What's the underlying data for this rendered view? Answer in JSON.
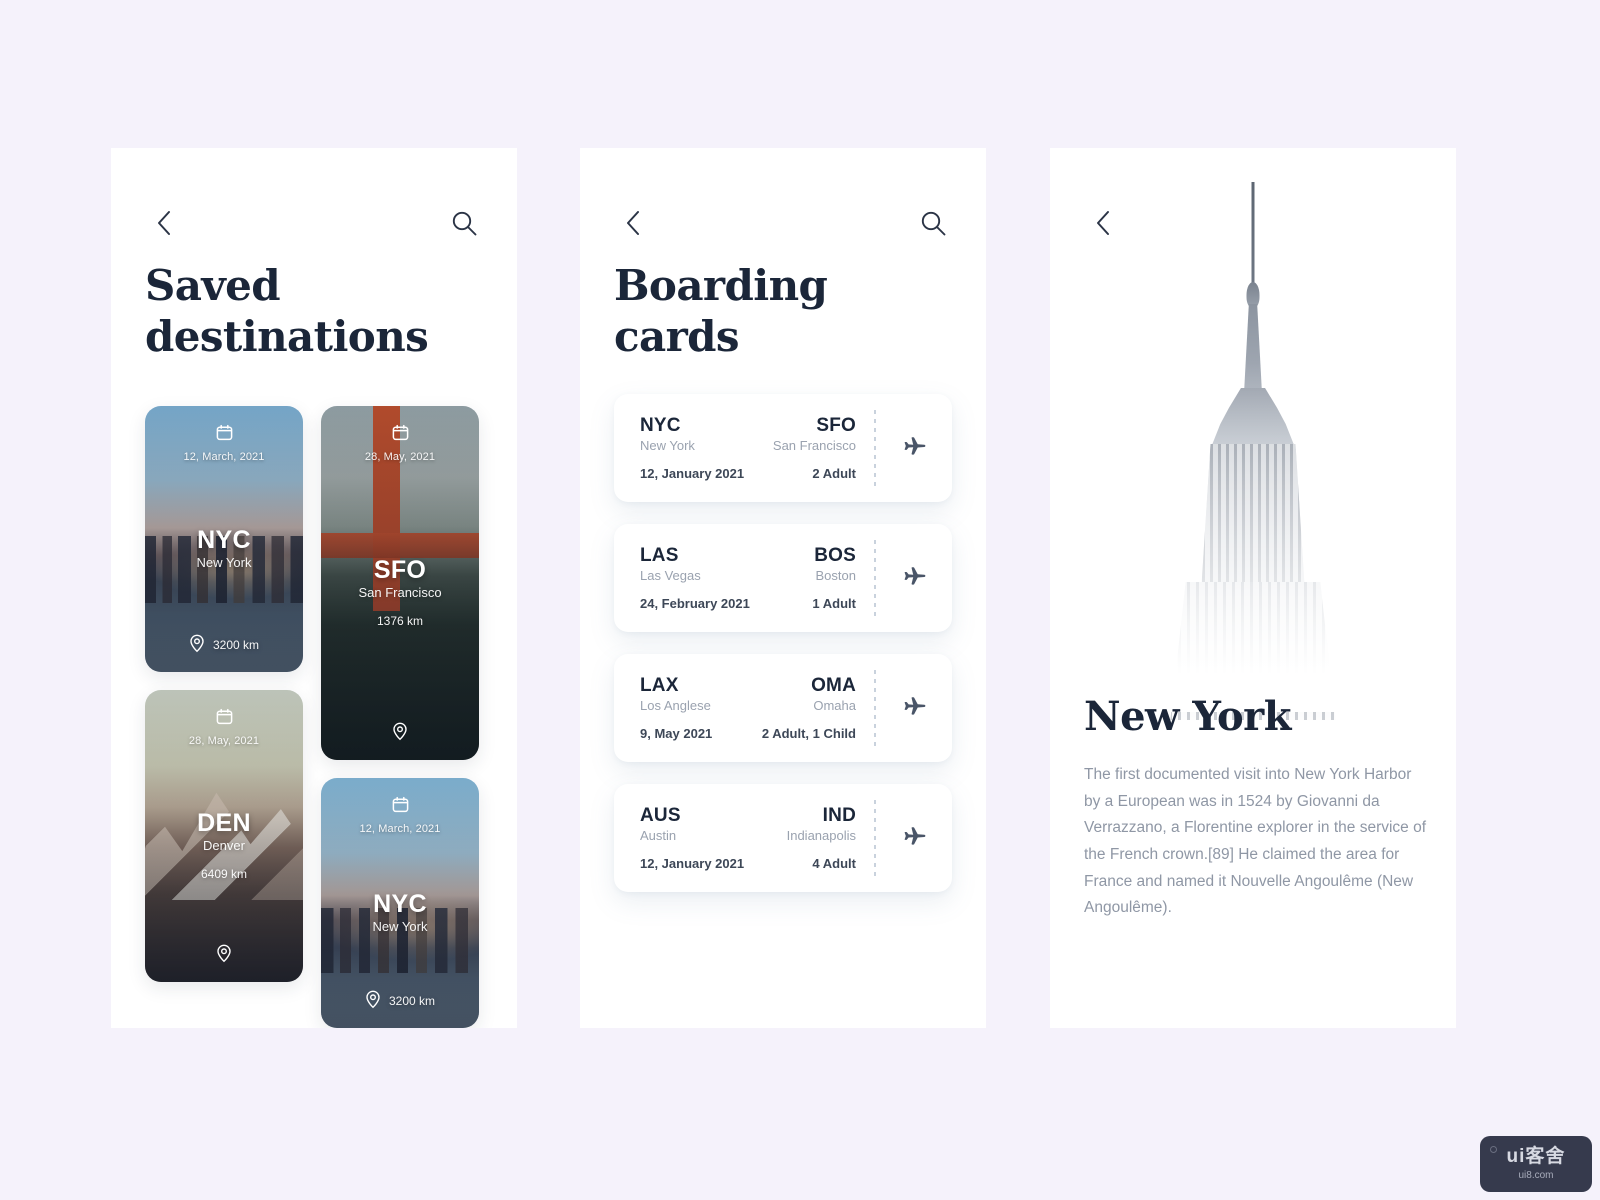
{
  "background_color": "#f5f2fb",
  "accent_color": "#1b2639",
  "muted_color": "#9aa2af",
  "saved": {
    "back_icon": "chevron-left-icon",
    "search_icon": "search-icon",
    "title_line1": "Saved",
    "title_line2": "destinations",
    "destinations": [
      {
        "code": "NYC",
        "city": "New York",
        "date": "12, March, 2021",
        "distance": "3200 km",
        "calendar_icon": "calendar-icon",
        "pin_icon": "location-pin-icon"
      },
      {
        "code": "SFO",
        "city": "San Francisco",
        "date": "28, May, 2021",
        "distance": "1376 km",
        "calendar_icon": "calendar-icon",
        "pin_icon": "location-pin-icon"
      },
      {
        "code": "DEN",
        "city": "Denver",
        "date": "28, May, 2021",
        "distance": "6409 km",
        "calendar_icon": "calendar-icon",
        "pin_icon": "location-pin-icon"
      },
      {
        "code": "NYC",
        "city": "New York",
        "date": "12, March, 2021",
        "distance": "3200 km",
        "calendar_icon": "calendar-icon",
        "pin_icon": "location-pin-icon"
      }
    ]
  },
  "boarding": {
    "back_icon": "chevron-left-icon",
    "search_icon": "search-icon",
    "title_line1": "Boarding",
    "title_line2": "cards",
    "cards": [
      {
        "from_code": "NYC",
        "from_city": "New York",
        "to_code": "SFO",
        "to_city": "San Francisco",
        "date": "12, January 2021",
        "passengers": "2 Adult",
        "plane_icon": "airplane-icon"
      },
      {
        "from_code": "LAS",
        "from_city": "Las Vegas",
        "to_code": "BOS",
        "to_city": "Boston",
        "date": "24, February 2021",
        "passengers": "1 Adult",
        "plane_icon": "airplane-icon"
      },
      {
        "from_code": "LAX",
        "from_city": "Los Anglese",
        "to_code": "OMA",
        "to_city": "Omaha",
        "date": "9, May 2021",
        "passengers": "2 Adult, 1 Child",
        "plane_icon": "airplane-icon"
      },
      {
        "from_code": "AUS",
        "from_city": "Austin",
        "to_code": "IND",
        "to_city": "Indianapolis",
        "date": "12, January 2021",
        "passengers": "4 Adult",
        "plane_icon": "airplane-icon"
      }
    ]
  },
  "detail": {
    "back_icon": "chevron-left-icon",
    "hero_image_alt": "empire-state-building",
    "title": "New York",
    "body": "The first documented visit into New York Harbor by a European was in 1524 by Giovanni da Verrazzano, a Florentine explorer in the service of the French crown.[89] He claimed the area for France and named it Nouvelle Angoulême (New Angoulême)."
  },
  "watermark": {
    "logo": "ui客舍",
    "url": "ui8.com"
  }
}
